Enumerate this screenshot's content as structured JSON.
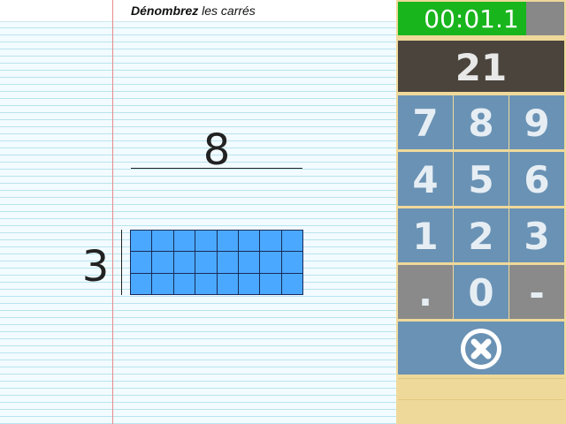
{
  "instruction": {
    "bold": "Dénombrez",
    "rest": " les carrés"
  },
  "problem": {
    "top_number": "8",
    "side_number": "3",
    "grid": {
      "columns": 8,
      "rows": 3
    }
  },
  "timer": {
    "text": "00:01.1",
    "progress": 0.77
  },
  "display": {
    "value": "21"
  },
  "keypad": {
    "keys": [
      "7",
      "8",
      "9",
      "4",
      "5",
      "6",
      "1",
      "2",
      "3",
      ".",
      "0",
      "-"
    ],
    "clear_icon": "close-circle-icon"
  },
  "colors": {
    "grid_fill": "#4aa9ff",
    "key_blue": "#6a92b4",
    "key_gray": "#8a8a8a",
    "timer_green": "#19b51d",
    "display_bg": "#4a443c",
    "panel_bg": "#efd99a",
    "margin_red": "#e88a8a"
  }
}
